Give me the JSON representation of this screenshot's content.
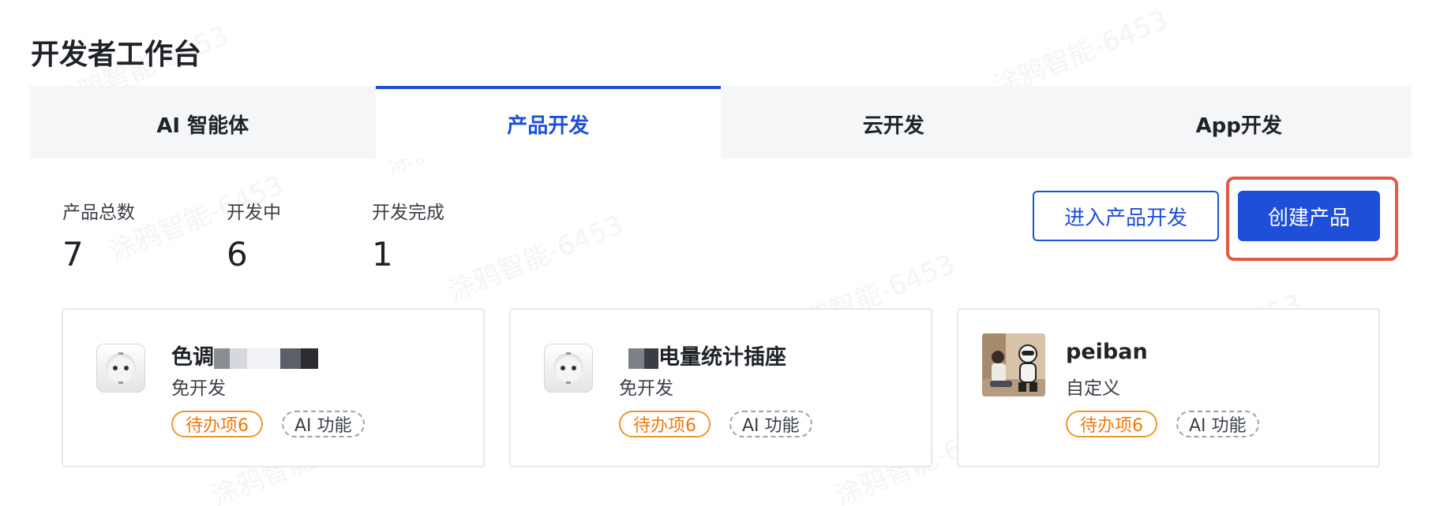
{
  "page_title": "开发者工作台",
  "watermark": "涂鸦智能-6453",
  "tabs": [
    {
      "label": "AI 智能体",
      "active": false
    },
    {
      "label": "产品开发",
      "active": true
    },
    {
      "label": "云开发",
      "active": false
    },
    {
      "label": "App开发",
      "active": false
    }
  ],
  "stats": [
    {
      "label": "产品总数",
      "value": "7"
    },
    {
      "label": "开发中",
      "value": "6"
    },
    {
      "label": "开发完成",
      "value": "1"
    }
  ],
  "actions": {
    "enter_label": "进入产品开发",
    "create_label": "创建产品"
  },
  "cards": [
    {
      "name": "色调",
      "type": "免开发",
      "todo": "待办项6",
      "ai": "AI 功能",
      "icon": "socket-icon"
    },
    {
      "name": "电量统计插座",
      "type": "免开发",
      "todo": "待办项6",
      "ai": "AI 功能",
      "icon": "socket-icon"
    },
    {
      "name": "peiban",
      "type": "自定义",
      "todo": "待办项6",
      "ai": "AI 功能",
      "icon": "robot-photo"
    }
  ],
  "colors": {
    "accent": "#1f4fd8",
    "highlight": "#e05a47",
    "todo": "#ee7a12"
  }
}
